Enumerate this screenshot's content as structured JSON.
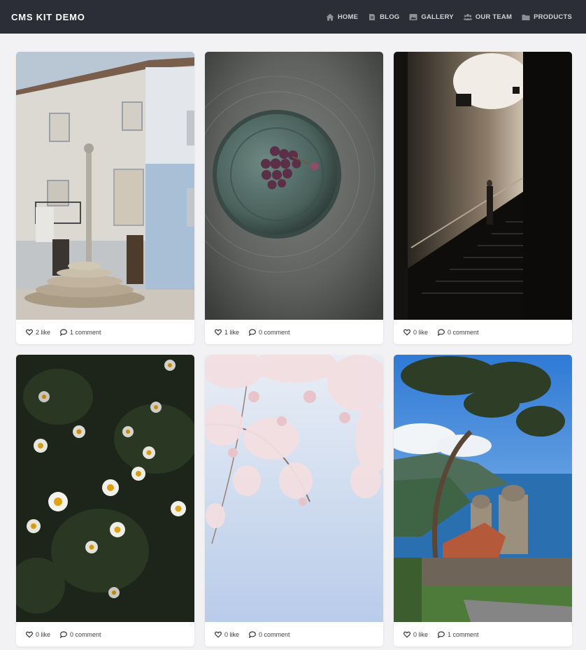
{
  "brand": "CMS KIT DEMO",
  "nav": [
    {
      "label": "HOME",
      "icon": "home-icon"
    },
    {
      "label": "BLOG",
      "icon": "blog-icon"
    },
    {
      "label": "GALLERY",
      "icon": "gallery-icon"
    },
    {
      "label": "OUR TEAM",
      "icon": "team-icon"
    },
    {
      "label": "PRODUCTS",
      "icon": "folder-icon"
    }
  ],
  "cards": [
    {
      "photo": "white-building-with-stone-column",
      "likes": "2 like",
      "comments": "1 comment"
    },
    {
      "photo": "grapes-on-metal-plate",
      "likes": "1 like",
      "comments": "0 comment"
    },
    {
      "photo": "woman-on-dark-staircase",
      "likes": "0 like",
      "comments": "0 comment"
    },
    {
      "photo": "chamomile-daisies",
      "likes": "0 like",
      "comments": "0 comment"
    },
    {
      "photo": "cherry-blossom-sky",
      "likes": "0 like",
      "comments": "0 comment"
    },
    {
      "photo": "pine-tree-coastal-church",
      "likes": "0 like",
      "comments": "1 comment"
    }
  ],
  "colors": {
    "navbar": "#2b2e36",
    "page_bg": "#f2f2f4",
    "card_bg": "#ffffff"
  }
}
